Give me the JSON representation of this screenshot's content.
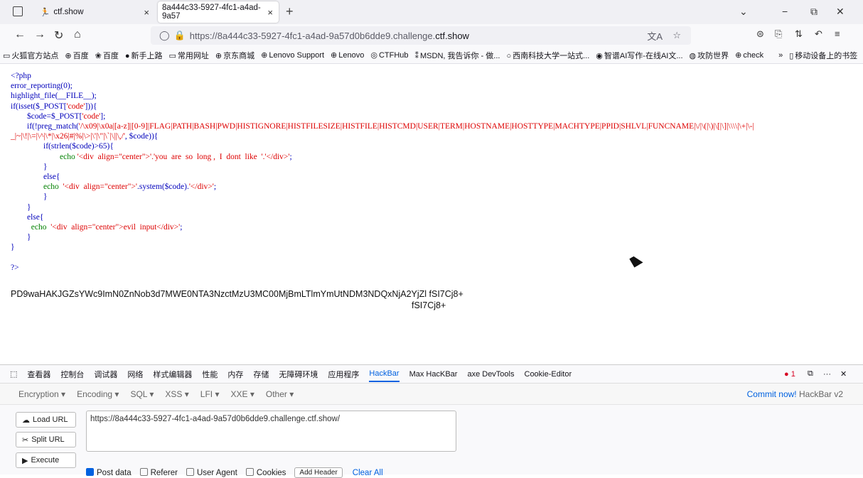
{
  "tabs": [
    {
      "title": "ctf.show",
      "close": "×"
    },
    {
      "title": "8a444c33-5927-4fc1-a4ad-9a57",
      "close": "×"
    }
  ],
  "new_tab_glyph": "+",
  "window_controls": {
    "min": "−",
    "restore": "⧉",
    "close": "✕",
    "dropdown": "⌄"
  },
  "nav": {
    "back": "←",
    "forward": "→",
    "reload": "↻",
    "home": "⌂"
  },
  "url": {
    "prefix": "https://8a444c33-5927-4fc1-a4ad-9a57d0b6dde9.challenge.",
    "domain": "ctf.show"
  },
  "bookmarks": [
    "火狐官方站点",
    "百度",
    "百度",
    "新手上路",
    "常用网址",
    "京东商城",
    "Lenovo Support",
    "Lenovo",
    "CTFHub",
    "MSDN, 我告诉你 - 做...",
    "西南科技大学一站式...",
    "智谱AI写作-在线AI文...",
    "攻防世界",
    "check",
    "»",
    "移动设备上的书签"
  ],
  "code": {
    "l1": "<?php",
    "l2": "error_reporting(0);",
    "l3": "highlight_file(__FILE__);",
    "l4a": "if(isset($_POST[",
    "l4b": "'code'",
    "l4c": "])){",
    "l5a": "        $code=$_POST[",
    "l5b": "'code'",
    "l5c": "];",
    "l6a": "        if(!preg_match(",
    "l6b": "'/\\x09|\\x0a|[a-z]|[0-9]|FLAG|PATH|BASH|PWD|HISTIGNORE|HISTFILESIZE|HISTFILE|HISTCMD|USER|TERM|HOSTNAME|HOSTTYPE|MACHTYPE|PPID|SHLVL|FUNCNAME|\\/|\\(|\\)|\\[|\\]|\\\\\\\\|\\+|\\-|",
    "l7a": "_|~|\\!|\\=|\\^|\\*|\\x26|#|%|\\>|\\'|\\\"|\\`|\\||\\,/'",
    "l7b": ", $code)){",
    "l8a": "                if(strlen($code)>65){",
    "l9a": "                        echo ",
    "l9b": "'<div  align=\"center\">'.'you  are  so  long ,  I  dont  like  '.'</div>'",
    "l9c": ";",
    "l10": "                }",
    "l11": "                else{",
    "l12a": "                echo  ",
    "l12b": "'<div  align=\"center\">'",
    "l12c": ".system($code).",
    "l12d": "'</div>'",
    "l12e": ";",
    "l13": "                }",
    "l14": "        }",
    "l15": "        else{",
    "l16a": "          echo  ",
    "l16b": "'<div  align=\"center\">evil  input</div>'",
    "l16c": ";",
    "l17": "        }",
    "l18": "}",
    "l19": "",
    "l20": "?>"
  },
  "output": {
    "line1": "PD9waHAKJGZsYWc9ImN0ZnNob3d7MWE0NTA3NzctMzU3MC00MjBmLTlmYmUtNDM3NDQxNjA2YjZl fSI7Cj8+",
    "line2": "fSI7Cj8+"
  },
  "devtools": {
    "tabs": [
      "查看器",
      "控制台",
      "调试器",
      "网络",
      "样式编辑器",
      "性能",
      "内存",
      "存储",
      "无障碍环境",
      "应用程序",
      "HackBar",
      "Max HacKBar",
      "axe DevTools",
      "Cookie-Editor"
    ],
    "error_count": "1",
    "more": "···",
    "close": "✕"
  },
  "hackbar": {
    "menus": [
      "Encryption ▾",
      "Encoding ▾",
      "SQL ▾",
      "XSS ▾",
      "LFI ▾",
      "XXE ▾",
      "Other ▾"
    ],
    "commit_link": "Commit now!",
    "commit_version": " HackBar v2",
    "load_url": "Load URL",
    "split_url": "Split URL",
    "execute": "Execute",
    "url_value": "https://8a444c33-5927-4fc1-a4ad-9a57d0b6dde9.challenge.ctf.show/",
    "post_data": "Post data",
    "referer": "Referer",
    "user_agent": "User Agent",
    "cookies": "Cookies",
    "add_header": "Add Header",
    "clear_all": "Clear All"
  }
}
